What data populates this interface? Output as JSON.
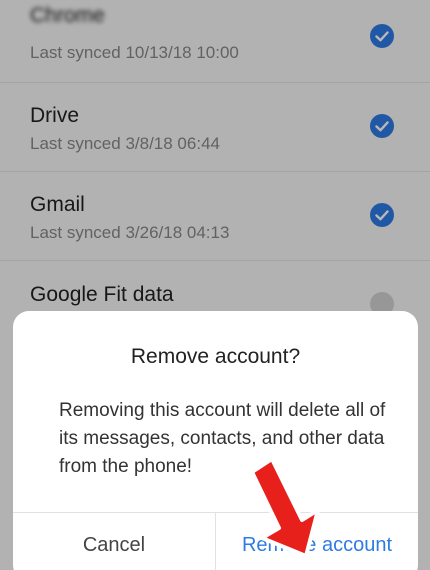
{
  "sync_items": [
    {
      "name": "Chrome",
      "status": "Last synced 10/13/18 10:00",
      "checked": true
    },
    {
      "name": "Drive",
      "status": "Last synced 3/8/18 06:44",
      "checked": true
    },
    {
      "name": "Gmail",
      "status": "Last synced 3/26/18 04:13",
      "checked": true
    },
    {
      "name": "Google Fit data",
      "status": "",
      "checked": false
    }
  ],
  "dialog": {
    "title": "Remove account?",
    "message": "Removing this account will delete all of its messages, contacts, and other data from the phone!",
    "cancel_label": "Cancel",
    "remove_label": "Remove account"
  },
  "colors": {
    "accent": "#2f7be5",
    "annotation_arrow": "#e8201c"
  },
  "icons": {
    "checked": "check-circle-icon",
    "unchecked": "empty-circle-icon",
    "annotation": "red-arrow-annotation"
  }
}
